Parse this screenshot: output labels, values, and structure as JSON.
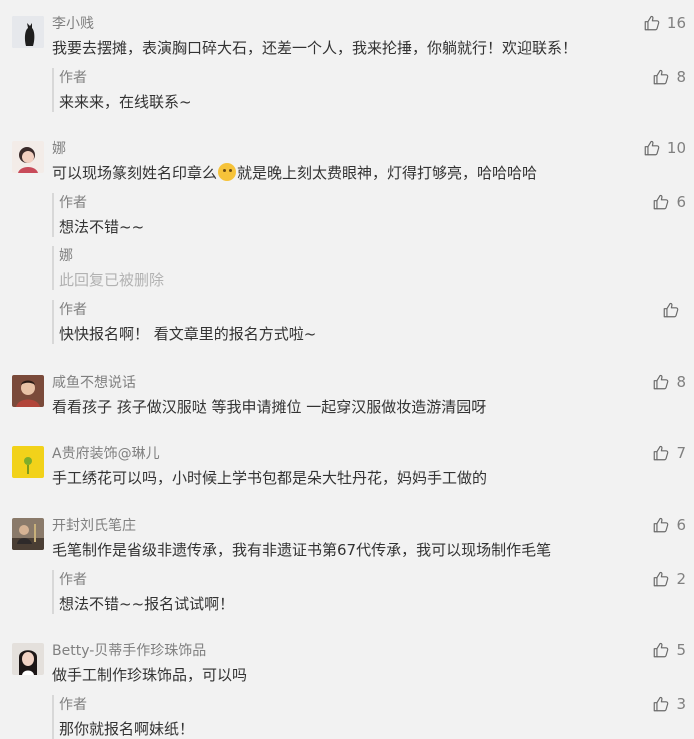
{
  "comments": [
    {
      "nickname": "李小贱",
      "text": "我要去摆摊，表演胸口碎大石，还差一个人，我来抡捶，你躺就行！欢迎联系！",
      "likes": "16",
      "avatar_icon": "black-cat-avatar",
      "replies": [
        {
          "nickname": "作者",
          "text": "来来来，在线联系~",
          "likes": "8"
        }
      ]
    },
    {
      "nickname": "娜",
      "text_before": "可以现场篆刻姓名印章么",
      "emoji": "thinking-face-icon",
      "text_after": "就是晚上刻太费眼神，灯得打够亮，哈哈哈哈",
      "likes": "10",
      "avatar_icon": "woman-portrait-avatar",
      "replies": [
        {
          "nickname": "作者",
          "text": "想法不错~~",
          "likes": "6"
        },
        {
          "nickname": "娜",
          "text": "此回复已被删除",
          "likes": ""
        },
        {
          "nickname": "作者",
          "text": "快快报名啊！ 看文章里的报名方式啦~",
          "likes": ""
        }
      ]
    },
    {
      "nickname": "咸鱼不想说话",
      "text": "看看孩子 孩子做汉服哒 等我申请摊位 一起穿汉服做妆造游清园呀",
      "likes": "8",
      "avatar_icon": "child-photo-avatar",
      "replies": []
    },
    {
      "nickname": "A贵府装饰@琳儿",
      "text": "手工绣花可以吗，小时候上学书包都是朵大牡丹花，妈妈手工做的",
      "likes": "7",
      "avatar_icon": "yellow-flower-avatar",
      "replies": []
    },
    {
      "nickname": "开封刘氏笔庄",
      "text": "毛笔制作是省级非遗传承，我有非遗证书第67代传承，我可以现场制作毛笔",
      "likes": "6",
      "avatar_icon": "craftsman-photo-avatar",
      "replies": [
        {
          "nickname": "作者",
          "text": "想法不错~~报名试试啊！",
          "likes": "2"
        }
      ]
    },
    {
      "nickname": "Betty-贝蒂手作珍珠饰品",
      "text": "做手工制作珍珠饰品，可以吗",
      "likes": "5",
      "avatar_icon": "woman-selfie-avatar",
      "replies": [
        {
          "nickname": "作者",
          "text": "那你就报名啊妹纸！",
          "likes": "3"
        }
      ]
    }
  ]
}
